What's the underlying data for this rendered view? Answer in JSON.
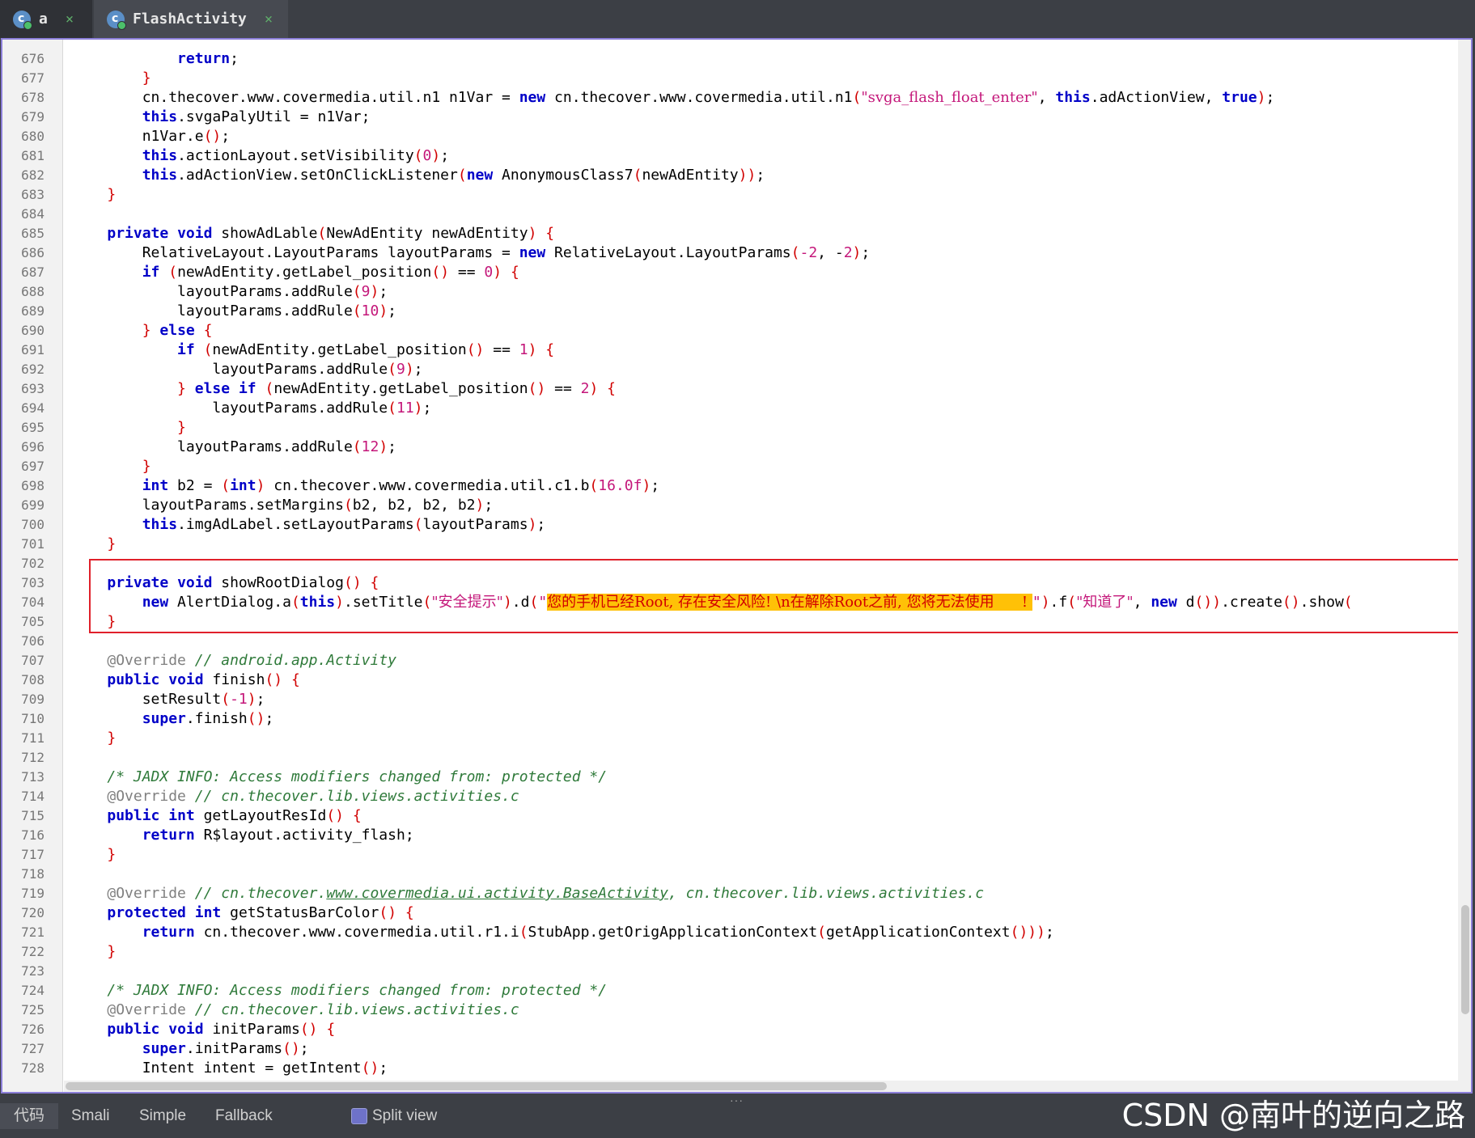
{
  "tabs": [
    {
      "label": "a",
      "close": "×"
    },
    {
      "label": "FlashActivity",
      "close": "×"
    }
  ],
  "line_numbers": [
    "676",
    "677",
    "678",
    "679",
    "680",
    "681",
    "682",
    "683",
    "684",
    "685",
    "686",
    "687",
    "688",
    "689",
    "690",
    "691",
    "692",
    "693",
    "694",
    "695",
    "696",
    "697",
    "698",
    "699",
    "700",
    "701",
    "702",
    "703",
    "704",
    "705",
    "706",
    "707",
    "708",
    "709",
    "710",
    "711",
    "712",
    "713",
    "714",
    "715",
    "716",
    "717",
    "718",
    "719",
    "720",
    "721",
    "722",
    "723",
    "724",
    "725",
    "726",
    "727",
    "728"
  ],
  "code_lines": [
    "            return;",
    "        }",
    "        cn.thecover.www.covermedia.util.n1 n1Var = new cn.thecover.www.covermedia.util.n1(\"svga_flash_float_enter\", this.adActionView, true);",
    "        this.svgaPalyUtil = n1Var;",
    "        n1Var.e();",
    "        this.actionLayout.setVisibility(0);",
    "        this.adActionView.setOnClickListener(new AnonymousClass7(newAdEntity));",
    "    }",
    "",
    "    private void showAdLable(NewAdEntity newAdEntity) {",
    "        RelativeLayout.LayoutParams layoutParams = new RelativeLayout.LayoutParams(-2, -2);",
    "        if (newAdEntity.getLabel_position() == 0) {",
    "            layoutParams.addRule(9);",
    "            layoutParams.addRule(10);",
    "        } else {",
    "            if (newAdEntity.getLabel_position() == 1) {",
    "                layoutParams.addRule(9);",
    "            } else if (newAdEntity.getLabel_position() == 2) {",
    "                layoutParams.addRule(11);",
    "            }",
    "            layoutParams.addRule(12);",
    "        }",
    "        int b2 = (int) cn.thecover.www.covermedia.util.c1.b(16.0f);",
    "        layoutParams.setMargins(b2, b2, b2, b2);",
    "        this.imgAdLabel.setLayoutParams(layoutParams);",
    "    }",
    "",
    "    private void showRootDialog() {",
    "        new AlertDialog.a(this).setTitle(\"安全提示\").d(\"您的手机已经Root, 存在安全风险! \\n在解除Root之前, 您将无法使用      ! \").f(\"知道了\", new d()).create().show(",
    "    }",
    "",
    "    @Override // android.app.Activity",
    "    public void finish() {",
    "        setResult(-1);",
    "        super.finish();",
    "    }",
    "",
    "    /* JADX INFO: Access modifiers changed from: protected */",
    "    @Override // cn.thecover.lib.views.activities.c",
    "    public int getLayoutResId() {",
    "        return R$layout.activity_flash;",
    "    }",
    "",
    "    @Override // cn.thecover.www.covermedia.ui.activity.BaseActivity, cn.thecover.lib.views.activities.c",
    "    protected int getStatusBarColor() {",
    "        return cn.thecover.www.covermedia.util.r1.i(StubApp.getOrigApplicationContext(getApplicationContext()));",
    "    }",
    "",
    "    /* JADX INFO: Access modifiers changed from: protected */",
    "    @Override // cn.thecover.lib.views.activities.c",
    "    public void initParams() {",
    "        super.initParams();",
    "        Intent intent = getIntent();"
  ],
  "highlighted_lines": [
    "703",
    "704",
    "705"
  ],
  "bottom_tabs": {
    "code": "代码",
    "smali": "Smali",
    "simple": "Simple",
    "fallback": "Fallback",
    "split_view": "Split view"
  },
  "watermark": "CSDN @南叶的逆向之路",
  "colors": {
    "keyword": "#0000c8",
    "bracket": "#d10000",
    "string": "#c4177a",
    "comment": "#2f7a3a",
    "highlight": "#ffc107",
    "selection_box": "#e0202a",
    "frame": "#8c7fd9"
  }
}
